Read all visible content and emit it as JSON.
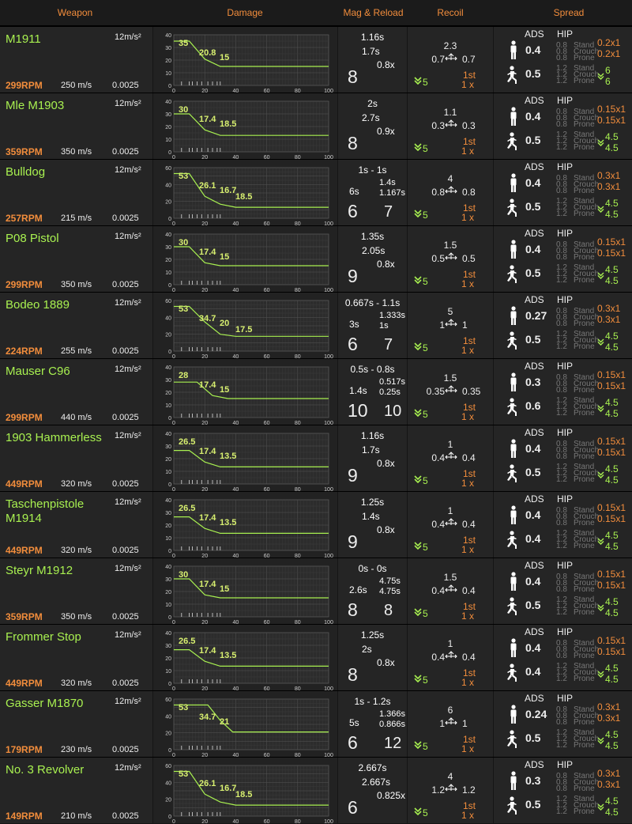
{
  "headers": {
    "weapon": "Weapon",
    "damage": "Damage",
    "mag": "Mag & Reload",
    "recoil": "Recoil",
    "spread": "Spread"
  },
  "spread_labels": {
    "ads": "ADS",
    "hip": "HIP",
    "stand": "Stand",
    "crouch": "Crouch",
    "prone": "Prone",
    "stand_val": "0.8",
    "crouch_val": "0.8",
    "prone_val": "0.8",
    "move_val": "1.2"
  },
  "chart_axes": {
    "x_ticks": [
      "0",
      "20",
      "40",
      "60",
      "80",
      "100"
    ],
    "y_ticks": [
      "0",
      "20",
      "40",
      "60"
    ]
  },
  "weapons": [
    {
      "name": "M1911",
      "accel": "12m/s²",
      "rpm": "299RPM",
      "velocity": "250 m/s",
      "drag": "0.0025",
      "dmg_labels": [
        "35",
        "20.8",
        "15"
      ],
      "dmg_curve": [
        [
          0,
          35
        ],
        [
          10,
          35
        ],
        [
          20,
          20.8
        ],
        [
          30,
          15
        ],
        [
          100,
          15
        ]
      ],
      "ymax": 40,
      "mag_top": "1.16s",
      "mag_mid": "1.7s",
      "mag_mult": "0.8x",
      "mag_big": "8",
      "mag_big2": "",
      "recoil_up": "2.3",
      "recoil_left": "0.7",
      "recoil_right": "0.7",
      "recoil_first": "1st",
      "recoil_mult": "1 x",
      "recoil_green": "5",
      "ads_stand": "0.4",
      "ads_move": "0.5",
      "hip_stand": "0.2x1",
      "hip_crouch": "0.2x1",
      "hip_move": "6",
      "hip_move2": "6"
    },
    {
      "name": "Mle M1903",
      "accel": "12m/s²",
      "rpm": "359RPM",
      "velocity": "350 m/s",
      "drag": "0.0025",
      "dmg_labels": [
        "30",
        "17.4",
        "18.5"
      ],
      "dmg_curve": [
        [
          0,
          30
        ],
        [
          10,
          30
        ],
        [
          20,
          17.4
        ],
        [
          30,
          13
        ],
        [
          100,
          13
        ]
      ],
      "ymax": 40,
      "mag_top": "2s",
      "mag_mid": "2.7s",
      "mag_mult": "0.9x",
      "mag_big": "8",
      "mag_big2": "",
      "recoil_up": "1.1",
      "recoil_left": "0.3",
      "recoil_right": "0.3",
      "recoil_first": "1st",
      "recoil_mult": "1 x",
      "recoil_green": "5",
      "ads_stand": "0.4",
      "ads_move": "0.5",
      "hip_stand": "0.15x1",
      "hip_crouch": "0.15x1",
      "hip_move": "4.5",
      "hip_move2": "4.5"
    },
    {
      "name": "Bulldog",
      "accel": "12m/s²",
      "rpm": "257RPM",
      "velocity": "215 m/s",
      "drag": "0.0025",
      "dmg_labels": [
        "53",
        "26.1",
        "16.7",
        "18.5"
      ],
      "dmg_curve": [
        [
          0,
          53
        ],
        [
          10,
          53
        ],
        [
          20,
          26.1
        ],
        [
          30,
          16.7
        ],
        [
          40,
          13
        ],
        [
          100,
          13
        ]
      ],
      "ymax": 60,
      "mag_top": "1s - 1s",
      "mag_mid": "6s",
      "mag_mult": "1.4s",
      "mag_mult2": "1.167s",
      "mag_big": "6",
      "mag_big2": "7",
      "recoil_up": "4",
      "recoil_left": "0.8",
      "recoil_right": "0.8",
      "recoil_first": "1st",
      "recoil_mult": "1 x",
      "recoil_green": "5",
      "ads_stand": "0.4",
      "ads_move": "0.5",
      "hip_stand": "0.3x1",
      "hip_crouch": "0.3x1",
      "hip_move": "4.5",
      "hip_move2": "4.5"
    },
    {
      "name": "P08 Pistol",
      "accel": "12m/s²",
      "rpm": "299RPM",
      "velocity": "350 m/s",
      "drag": "0.0025",
      "dmg_labels": [
        "30",
        "17.4",
        "15"
      ],
      "dmg_curve": [
        [
          0,
          30
        ],
        [
          10,
          30
        ],
        [
          20,
          17.4
        ],
        [
          30,
          15
        ],
        [
          100,
          15
        ]
      ],
      "ymax": 40,
      "mag_top": "1.35s",
      "mag_mid": "2.05s",
      "mag_mult": "0.8x",
      "mag_big": "9",
      "mag_big2": "",
      "recoil_up": "1.5",
      "recoil_left": "0.5",
      "recoil_right": "0.5",
      "recoil_first": "1st",
      "recoil_mult": "1 x",
      "recoil_green": "5",
      "ads_stand": "0.4",
      "ads_move": "0.5",
      "hip_stand": "0.15x1",
      "hip_crouch": "0.15x1",
      "hip_move": "4.5",
      "hip_move2": "4.5"
    },
    {
      "name": "Bodeo 1889",
      "accel": "12m/s²",
      "rpm": "224RPM",
      "velocity": "255 m/s",
      "drag": "0.0025",
      "dmg_labels": [
        "53",
        "34.7",
        "20",
        "17.5"
      ],
      "dmg_curve": [
        [
          0,
          53
        ],
        [
          10,
          53
        ],
        [
          20,
          34.7
        ],
        [
          30,
          20
        ],
        [
          40,
          17.5
        ],
        [
          100,
          17.5
        ]
      ],
      "ymax": 60,
      "mag_top": "0.667s - 1.1s",
      "mag_mid": "3s",
      "mag_mult": "1.333s",
      "mag_mult2": "1s",
      "mag_big": "6",
      "mag_big2": "7",
      "recoil_up": "5",
      "recoil_left": "1",
      "recoil_right": "1",
      "recoil_first": "1st",
      "recoil_mult": "1 x",
      "recoil_green": "5",
      "ads_stand": "0.27",
      "ads_move": "0.5",
      "hip_stand": "0.3x1",
      "hip_crouch": "0.3x1",
      "hip_move": "4.5",
      "hip_move2": "4.5"
    },
    {
      "name": "Mauser C96",
      "accel": "12m/s²",
      "rpm": "299RPM",
      "velocity": "440 m/s",
      "drag": "0.0025",
      "dmg_labels": [
        "28",
        "17.4",
        "15"
      ],
      "dmg_curve": [
        [
          0,
          28
        ],
        [
          15,
          28
        ],
        [
          25,
          17.4
        ],
        [
          35,
          15
        ],
        [
          100,
          15
        ]
      ],
      "ymax": 40,
      "mag_top": "0.5s - 0.8s",
      "mag_mid": "1.4s",
      "mag_mult": "0.517s",
      "mag_mult2": "0.25s",
      "mag_big": "10",
      "mag_big2": "10",
      "recoil_up": "1.5",
      "recoil_left": "0.35",
      "recoil_right": "0.35",
      "recoil_first": "1st",
      "recoil_mult": "1 x",
      "recoil_green": "5",
      "ads_stand": "0.3",
      "ads_move": "0.6",
      "hip_stand": "0.15x1",
      "hip_crouch": "0.15x1",
      "hip_move": "4.5",
      "hip_move2": "4.5"
    },
    {
      "name": "1903 Hammerless",
      "accel": "12m/s²",
      "rpm": "449RPM",
      "velocity": "320 m/s",
      "drag": "0.0025",
      "dmg_labels": [
        "26.5",
        "17.4",
        "13.5"
      ],
      "dmg_curve": [
        [
          0,
          26.5
        ],
        [
          10,
          26.5
        ],
        [
          20,
          17.4
        ],
        [
          30,
          13.5
        ],
        [
          100,
          13.5
        ]
      ],
      "ymax": 40,
      "mag_top": "1.16s",
      "mag_mid": "1.7s",
      "mag_mult": "0.8x",
      "mag_big": "9",
      "mag_big2": "",
      "recoil_up": "1",
      "recoil_left": "0.4",
      "recoil_right": "0.4",
      "recoil_first": "1st",
      "recoil_mult": "1 x",
      "recoil_green": "5",
      "ads_stand": "0.4",
      "ads_move": "0.5",
      "hip_stand": "0.15x1",
      "hip_crouch": "0.15x1",
      "hip_move": "4.5",
      "hip_move2": "4.5"
    },
    {
      "name": "Taschenpistole M1914",
      "accel": "12m/s²",
      "rpm": "449RPM",
      "velocity": "320 m/s",
      "drag": "0.0025",
      "dmg_labels": [
        "26.5",
        "17.4",
        "13.5"
      ],
      "dmg_curve": [
        [
          0,
          26.5
        ],
        [
          10,
          26.5
        ],
        [
          20,
          17.4
        ],
        [
          30,
          13.5
        ],
        [
          100,
          13.5
        ]
      ],
      "ymax": 40,
      "mag_top": "1.25s",
      "mag_mid": "1.4s",
      "mag_mult": "0.8x",
      "mag_big": "9",
      "mag_big2": "",
      "recoil_up": "1",
      "recoil_left": "0.4",
      "recoil_right": "0.4",
      "recoil_first": "1st",
      "recoil_mult": "1 x",
      "recoil_green": "5",
      "ads_stand": "0.4",
      "ads_move": "0.4",
      "hip_stand": "0.15x1",
      "hip_crouch": "0.15x1",
      "hip_move": "4.5",
      "hip_move2": "4.5"
    },
    {
      "name": "Steyr M1912",
      "accel": "12m/s²",
      "rpm": "359RPM",
      "velocity": "350 m/s",
      "drag": "0.0025",
      "dmg_labels": [
        "30",
        "17.4",
        "15"
      ],
      "dmg_curve": [
        [
          0,
          30
        ],
        [
          10,
          30
        ],
        [
          20,
          17.4
        ],
        [
          30,
          15
        ],
        [
          100,
          15
        ]
      ],
      "ymax": 40,
      "mag_top": "0s - 0s",
      "mag_mid": "2.6s",
      "mag_mult": "4.75s",
      "mag_mult2": "4.75s",
      "mag_big": "8",
      "mag_big2": "8",
      "recoil_up": "1.5",
      "recoil_left": "0.4",
      "recoil_right": "0.4",
      "recoil_first": "1st",
      "recoil_mult": "1 x",
      "recoil_green": "5",
      "ads_stand": "0.4",
      "ads_move": "0.5",
      "hip_stand": "0.15x1",
      "hip_crouch": "0.15x1",
      "hip_move": "4.5",
      "hip_move2": "4.5"
    },
    {
      "name": "Frommer Stop",
      "accel": "12m/s²",
      "rpm": "449RPM",
      "velocity": "320 m/s",
      "drag": "0.0025",
      "dmg_labels": [
        "26.5",
        "17.4",
        "13.5"
      ],
      "dmg_curve": [
        [
          0,
          26.5
        ],
        [
          10,
          26.5
        ],
        [
          20,
          17.4
        ],
        [
          30,
          13.5
        ],
        [
          100,
          13.5
        ]
      ],
      "ymax": 40,
      "mag_top": "1.25s",
      "mag_mid": "2s",
      "mag_mult": "0.8x",
      "mag_big": "8",
      "mag_big2": "",
      "recoil_up": "1",
      "recoil_left": "0.4",
      "recoil_right": "0.4",
      "recoil_first": "1st",
      "recoil_mult": "1 x",
      "recoil_green": "5",
      "ads_stand": "0.4",
      "ads_move": "0.4",
      "hip_stand": "0.15x1",
      "hip_crouch": "0.15x1",
      "hip_move": "4.5",
      "hip_move2": "4.5"
    },
    {
      "name": "Gasser M1870",
      "accel": "12m/s²",
      "rpm": "179RPM",
      "velocity": "230 m/s",
      "drag": "0.0025",
      "dmg_labels": [
        "53",
        "34.7",
        "21"
      ],
      "dmg_curve": [
        [
          0,
          53
        ],
        [
          22,
          53
        ],
        [
          30,
          34.7
        ],
        [
          38,
          21
        ],
        [
          100,
          21
        ]
      ],
      "ymax": 60,
      "mag_top": "1s - 1.2s",
      "mag_mid": "5s",
      "mag_mult": "1.366s",
      "mag_mult2": "0.866s",
      "mag_big": "6",
      "mag_big2": "12",
      "recoil_up": "6",
      "recoil_left": "1",
      "recoil_right": "1",
      "recoil_first": "1st",
      "recoil_mult": "1 x",
      "recoil_green": "5",
      "ads_stand": "0.24",
      "ads_move": "0.5",
      "hip_stand": "0.3x1",
      "hip_crouch": "0.3x1",
      "hip_move": "4.5",
      "hip_move2": "4.5"
    },
    {
      "name": "No. 3 Revolver",
      "accel": "12m/s²",
      "rpm": "149RPM",
      "velocity": "210 m/s",
      "drag": "0.0025",
      "dmg_labels": [
        "53",
        "26.1",
        "16.7",
        "18.5"
      ],
      "dmg_curve": [
        [
          0,
          53
        ],
        [
          10,
          53
        ],
        [
          20,
          26.1
        ],
        [
          30,
          16.7
        ],
        [
          40,
          13
        ],
        [
          100,
          13
        ]
      ],
      "ymax": 60,
      "mag_top": "2.667s",
      "mag_mid": "2.667s",
      "mag_mult": "0.825x",
      "mag_big": "6",
      "mag_big2": "",
      "recoil_up": "4",
      "recoil_left": "1.2",
      "recoil_right": "1.2",
      "recoil_first": "1st",
      "recoil_mult": "1 x",
      "recoil_green": "5",
      "ads_stand": "0.3",
      "ads_move": "0.5",
      "hip_stand": "0.3x1",
      "hip_crouch": "0.3x1",
      "hip_move": "4.5",
      "hip_move2": "4.5"
    }
  ]
}
